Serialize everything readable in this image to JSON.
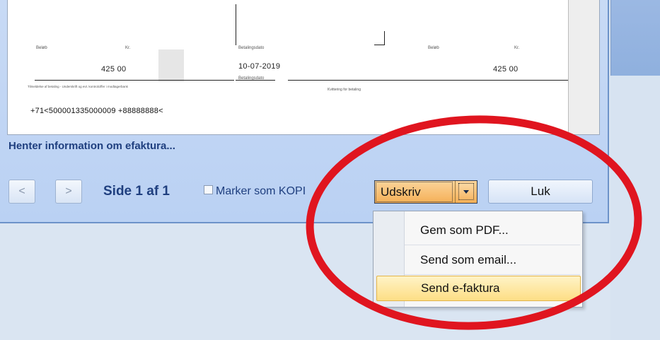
{
  "preview": {
    "label_left_a": "Beløb",
    "label_left_b": "Kr.",
    "amount_left": "425  00",
    "date_label": "Betalingsdato",
    "date_value": "10-07-2019",
    "date_sublabel": "Betalingsdato",
    "label_right_a": "Beløb",
    "label_right_b": "Kr.",
    "amount_right": "425  00",
    "fine_print_left": "Tilmeldelse af betaling - Underskrift og evt. kontrolciffer i modtagerbank",
    "fine_print_right": "Kvittering for betaling",
    "ocr_line": "+71<500001335000009 +88888888<"
  },
  "status": {
    "message": "Henter information om efaktura..."
  },
  "nav": {
    "prev_label": "<",
    "next_label": ">",
    "page_label": "Side 1 af 1"
  },
  "kopi": {
    "label": "Marker som KOPI",
    "checked": false
  },
  "print_button": {
    "label": "Udskriv",
    "arrow_icon": "dropdown-arrow-icon"
  },
  "close_button": {
    "label": "Luk"
  },
  "print_menu": {
    "items": [
      {
        "label": "Gem som PDF..."
      },
      {
        "label": "Send som email..."
      },
      {
        "label": "Send e-faktura",
        "selected": true
      }
    ]
  },
  "colors": {
    "status_text": "#1f3f7f",
    "window_bg": "#c8daf5",
    "button_hot": "#f5b057",
    "menu_highlight": "#fdde85",
    "annotation_red": "#e0151f"
  }
}
